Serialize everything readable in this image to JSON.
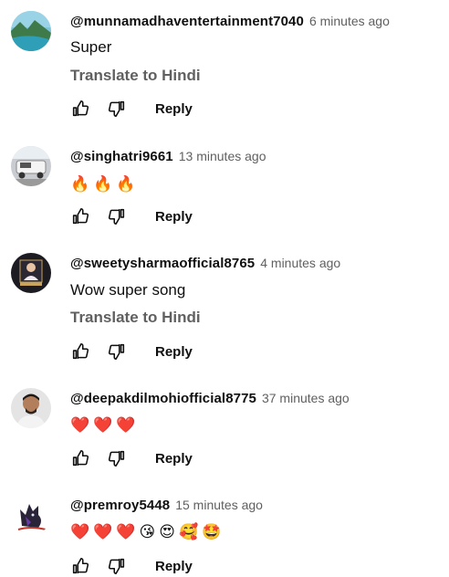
{
  "comments": [
    {
      "handle": "@munnamadhaventertainment7040",
      "time": "6 minutes ago",
      "text": "Super",
      "translate": "Translate to Hindi",
      "reply": "Reply",
      "avatar_icon": "landscape-avatar"
    },
    {
      "handle": "@singhatri9661",
      "time": "13 minutes ago",
      "emojis": [
        "🔥",
        "🔥",
        "🔥"
      ],
      "reply": "Reply",
      "avatar_icon": "car-avatar"
    },
    {
      "handle": "@sweetysharmaofficial8765",
      "time": "4 minutes ago",
      "text": "Wow super song",
      "translate": "Translate to Hindi",
      "reply": "Reply",
      "avatar_icon": "profile-badge-avatar"
    },
    {
      "handle": "@deepakdilmohiofficial8775",
      "time": "37 minutes ago",
      "emojis": [
        "❤️",
        "❤️",
        "❤️"
      ],
      "reply": "Reply",
      "avatar_icon": "man-portrait-avatar"
    },
    {
      "handle": "@premroy5448",
      "time": "15 minutes ago",
      "emojis": [
        "❤️",
        "❤️",
        "❤️",
        "😘",
        "😍",
        "🥰",
        "🤩"
      ],
      "reply": "Reply",
      "avatar_icon": "wolf-avatar"
    }
  ]
}
